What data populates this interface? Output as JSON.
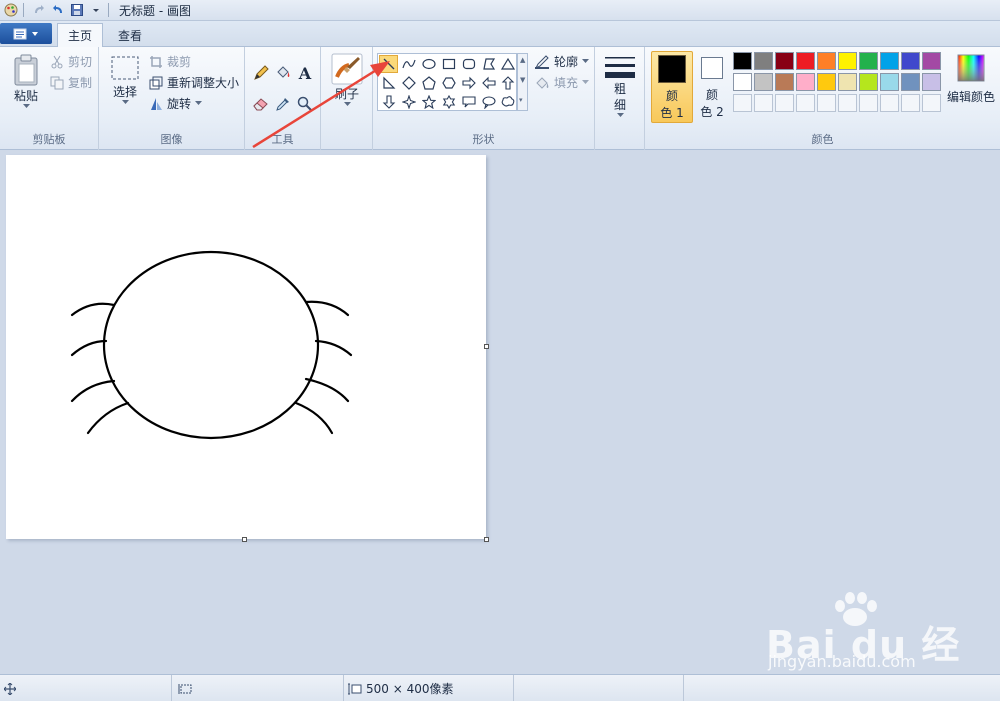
{
  "window": {
    "title": "无标题 - 画图"
  },
  "tabs": [
    {
      "label": "主页",
      "active": true
    },
    {
      "label": "查看",
      "active": false
    }
  ],
  "clipboard": {
    "paste_label": "粘贴",
    "cut_label": "剪切",
    "copy_label": "复制",
    "group_label": "剪贴板"
  },
  "image": {
    "select_label": "选择",
    "crop_label": "裁剪",
    "resize_label": "重新调整大小",
    "rotate_label": "旋转",
    "group_label": "图像"
  },
  "tools": {
    "group_label": "工具",
    "text_tool_glyph": "A"
  },
  "brushes": {
    "label": "刷子"
  },
  "shapes": {
    "group_label": "形状",
    "outline_label": "轮廓",
    "fill_label": "填充",
    "selected": "line"
  },
  "size": {
    "label": "粗细"
  },
  "colors": {
    "color1_label_a": "颜",
    "color1_label_b": "色 1",
    "color2_label_a": "颜",
    "color2_label_b": "色 2",
    "color1_value": "#000000",
    "color2_value": "#ffffff",
    "edit_label": "编辑颜色",
    "group_label": "颜色",
    "row1": [
      "#000000",
      "#7f7f7f",
      "#880015",
      "#ed1c24",
      "#ff7f27",
      "#fff200",
      "#22b14c",
      "#00a2e8",
      "#3f48cc",
      "#a349a4"
    ],
    "row2": [
      "#ffffff",
      "#c3c3c3",
      "#b97a57",
      "#ffaec9",
      "#ffc90e",
      "#efe4b0",
      "#b5e61d",
      "#99d9ea",
      "#7092be",
      "#c8bfe7"
    ]
  },
  "statusbar": {
    "size_text": "500 × 400像素"
  },
  "watermark": {
    "brand": "Bai du 经验",
    "url": "jingyan.baidu.com"
  }
}
